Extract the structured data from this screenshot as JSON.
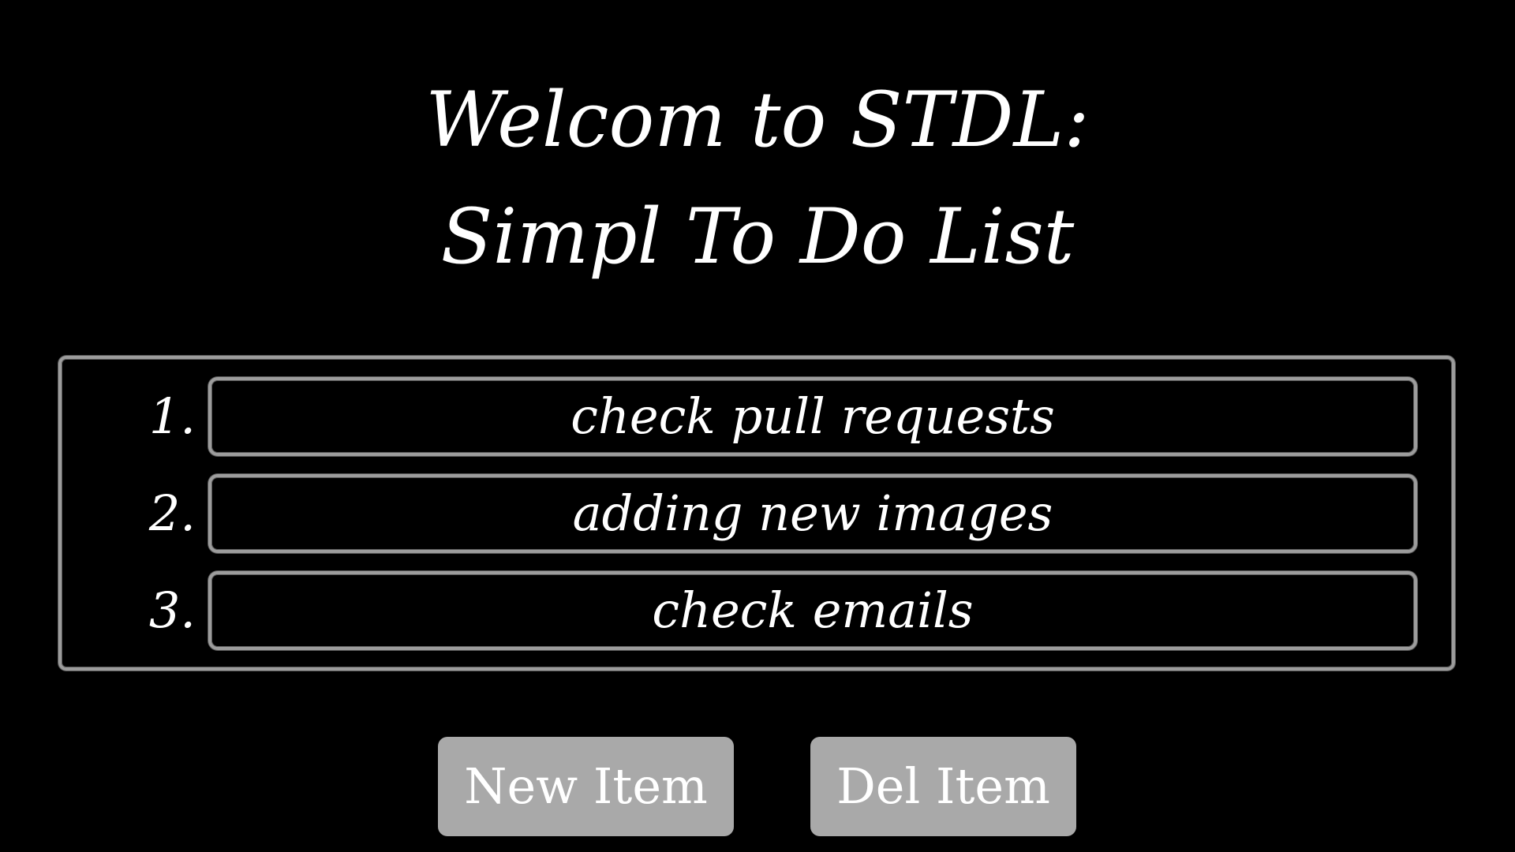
{
  "header": {
    "title_line_1": "Welcom to STDL:",
    "title_line_2": "Simpl To Do List"
  },
  "todo": {
    "items": [
      {
        "number": "1.",
        "text": "check pull requests"
      },
      {
        "number": "2.",
        "text": "adding new images"
      },
      {
        "number": "3.",
        "text": "check emails"
      }
    ]
  },
  "actions": {
    "new_label": "New Item",
    "del_label": "Del Item"
  },
  "colors": {
    "background": "#000000",
    "text": "#ffffff",
    "border": "#9c9c9c",
    "button_bg": "#a9a9a9"
  }
}
